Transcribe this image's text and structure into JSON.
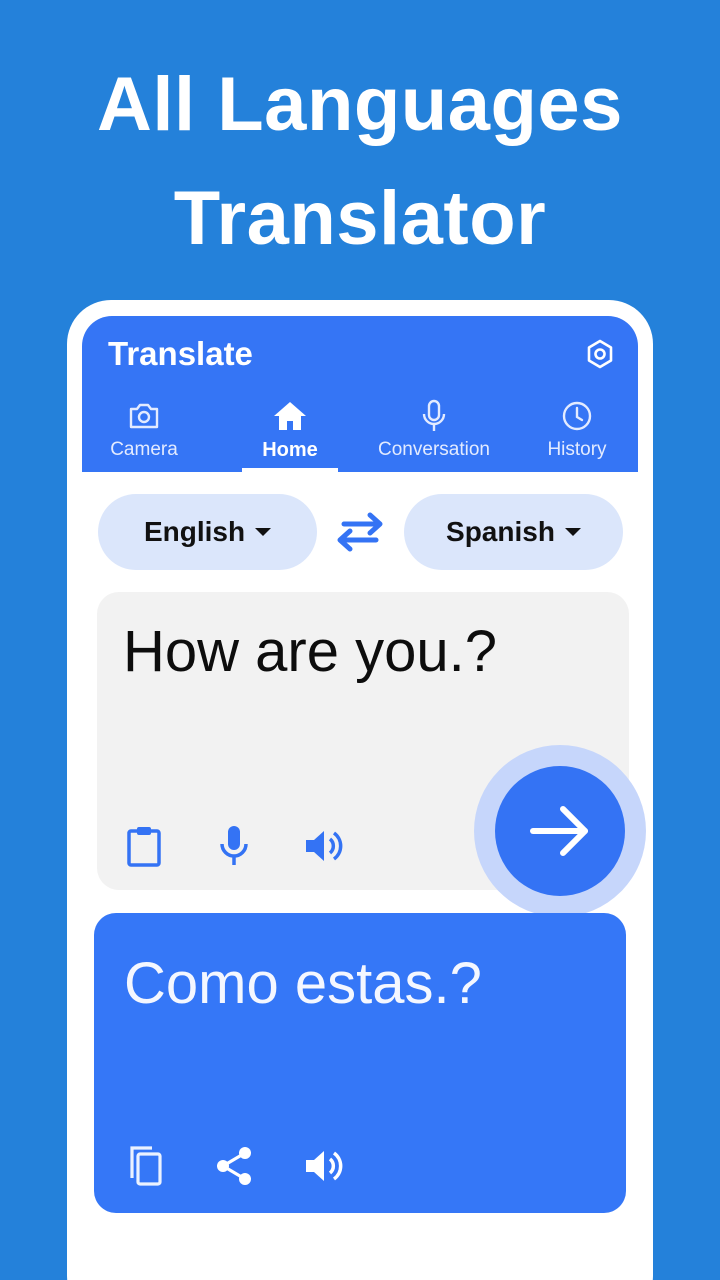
{
  "headline": {
    "line1": "All Languages",
    "line2": "Translator"
  },
  "app": {
    "title": "Translate",
    "settings_icon": "settings-hexagon-icon"
  },
  "tabs": [
    {
      "label": "Camera",
      "icon": "camera-icon",
      "active": false
    },
    {
      "label": "Home",
      "icon": "home-icon",
      "active": true
    },
    {
      "label": "Conversation",
      "icon": "microphone-icon",
      "active": false
    },
    {
      "label": "History",
      "icon": "clock-icon",
      "active": false
    }
  ],
  "languages": {
    "source": "English",
    "target": "Spanish",
    "swap_icon": "swap-arrows-icon"
  },
  "input": {
    "text": "How are you.?",
    "actions": [
      "clipboard-icon",
      "microphone-icon",
      "speaker-icon"
    ]
  },
  "translate_button": {
    "icon": "arrow-right-icon"
  },
  "output": {
    "text": "Como estas.?",
    "actions": [
      "copy-icon",
      "share-icon",
      "speaker-icon"
    ]
  },
  "colors": {
    "background": "#2481da",
    "primary": "#3575f5",
    "pill": "#dbe6fb",
    "input_card": "#f2f2f2",
    "halo": "#c6d6fb"
  }
}
